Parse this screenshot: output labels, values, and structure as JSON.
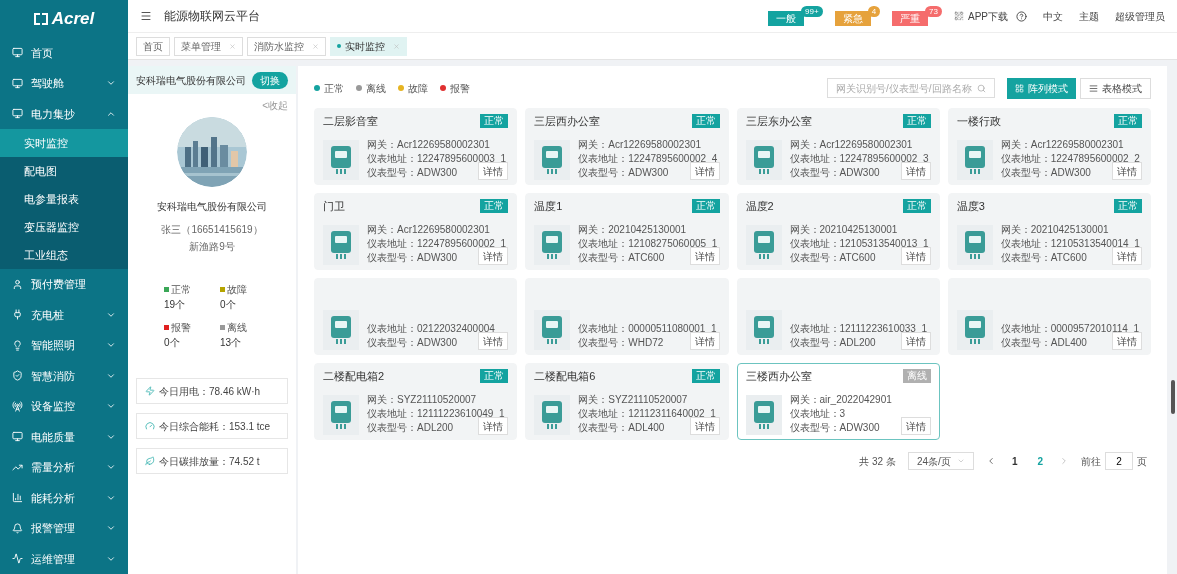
{
  "logo": "Acrel",
  "sidebar": {
    "items": [
      {
        "label": "首页"
      },
      {
        "label": "驾驶舱",
        "expanded": false
      },
      {
        "label": "电力集抄",
        "expanded": true,
        "children": [
          {
            "label": "实时监控",
            "selected": true
          },
          {
            "label": "配电图",
            "selected": false
          },
          {
            "label": "电参量报表",
            "selected": false
          },
          {
            "label": "变压器监控",
            "selected": false
          },
          {
            "label": "工业组态",
            "selected": false
          }
        ]
      },
      {
        "label": "预付费管理"
      },
      {
        "label": "充电桩",
        "expanded": false
      },
      {
        "label": "智能照明",
        "expanded": false
      },
      {
        "label": "智慧消防",
        "expanded": false
      },
      {
        "label": "设备监控",
        "expanded": false
      },
      {
        "label": "电能质量",
        "expanded": false
      },
      {
        "label": "需量分析",
        "expanded": false
      },
      {
        "label": "能耗分析",
        "expanded": false
      },
      {
        "label": "报警管理",
        "expanded": false
      },
      {
        "label": "运维管理",
        "expanded": false
      }
    ]
  },
  "header": {
    "title": "能源物联网云平台",
    "alarms": [
      {
        "label": "一般",
        "count": "99+",
        "color": "#14a3a0"
      },
      {
        "label": "紧急",
        "count": "4",
        "color": "#e6a23c"
      },
      {
        "label": "严重",
        "count": "73",
        "color": "#f56c6c"
      }
    ],
    "links": [
      "APP下载",
      "中文",
      "主题",
      "超级管理员"
    ]
  },
  "tabs": [
    {
      "label": "首页",
      "selected": false
    },
    {
      "label": "菜单管理",
      "selected": false
    },
    {
      "label": "消防水监控",
      "selected": false
    },
    {
      "label": "实时监控",
      "selected": true
    }
  ],
  "company_panel": {
    "name": "安科瑞电气股份有限公司",
    "switch_button": "切换",
    "collapse": "<收起",
    "company": "安科瑞电气股份有限公司",
    "contact": "张三（16651415619）",
    "address": "新渔路9号",
    "stats": [
      {
        "label": "正常",
        "count": "19个",
        "color": "#3aa757"
      },
      {
        "label": "故障",
        "count": "0个",
        "color": "#b5a400"
      },
      {
        "label": "报警",
        "count": "0个",
        "color": "#e02020"
      },
      {
        "label": "离线",
        "count": "13个",
        "color": "#999999"
      }
    ],
    "metrics": [
      "今日用电：78.46 kW·h",
      "今日综合能耗：153.1 tce",
      "今日碳排放量：74.52 t"
    ]
  },
  "legend": [
    {
      "label": "正常",
      "color": "#14a3a0"
    },
    {
      "label": "离线",
      "color": "#999999"
    },
    {
      "label": "故障",
      "color": "#e6b422"
    },
    {
      "label": "报警",
      "color": "#e03030"
    }
  ],
  "search": {
    "placeholder": "网关识别号/仪表型号/回路名称"
  },
  "view_modes": [
    {
      "label": "阵列模式",
      "selected": true
    },
    {
      "label": "表格模式",
      "selected": false
    }
  ],
  "cards": [
    {
      "title": "二层影音室",
      "status_label": "正常",
      "offline": false,
      "selected": false,
      "lines": [
        "网关：Acr12269580002301",
        "仪表地址：12247895600003_1",
        "仪表型号：ADW300"
      ],
      "button": "详情"
    },
    {
      "title": "三层西办公室",
      "status_label": "正常",
      "offline": false,
      "selected": false,
      "lines": [
        "网关：Acr12269580002301",
        "仪表地址：12247895600002_4",
        "仪表型号：ADW300"
      ],
      "button": "详情"
    },
    {
      "title": "三层东办公室",
      "status_label": "正常",
      "offline": false,
      "selected": false,
      "lines": [
        "网关：Acr12269580002301",
        "仪表地址：12247895600002_3",
        "仪表型号：ADW300"
      ],
      "button": "详情"
    },
    {
      "title": "一楼行政",
      "status_label": "正常",
      "offline": false,
      "selected": false,
      "lines": [
        "网关：Acr12269580002301",
        "仪表地址：12247895600002_2",
        "仪表型号：ADW300"
      ],
      "button": "详情"
    },
    {
      "title": "门卫",
      "status_label": "正常",
      "offline": false,
      "selected": false,
      "lines": [
        "网关：Acr12269580002301",
        "仪表地址：12247895600002_1",
        "仪表型号：ADW300"
      ],
      "button": "详情"
    },
    {
      "title": "温度1",
      "status_label": "正常",
      "offline": false,
      "selected": false,
      "lines": [
        "网关：20210425130001",
        "仪表地址：12108275060005_1",
        "仪表型号：ATC600"
      ],
      "button": "详情"
    },
    {
      "title": "温度2",
      "status_label": "正常",
      "offline": false,
      "selected": false,
      "lines": [
        "网关：20210425130001",
        "仪表地址：12105313540013_1",
        "仪表型号：ATC600"
      ],
      "button": "详情"
    },
    {
      "title": "温度3",
      "status_label": "正常",
      "offline": false,
      "selected": false,
      "lines": [
        "网关：20210425130001",
        "仪表地址：12105313540014_1",
        "仪表型号：ATC600"
      ],
      "button": "详情"
    },
    {
      "selected": false,
      "lines": [
        "仪表地址：02122032400004",
        "仪表型号：ADW300"
      ],
      "button": "详情"
    },
    {
      "selected": false,
      "lines": [
        "仪表地址：00000511080001_1",
        "仪表型号：WHD72"
      ],
      "button": "详情"
    },
    {
      "selected": false,
      "lines": [
        "仪表地址：12111223610033_1",
        "仪表型号：ADL200"
      ],
      "button": "详情"
    },
    {
      "selected": false,
      "lines": [
        "仪表地址：00009572010114_1",
        "仪表型号：ADL400"
      ],
      "button": "详情"
    },
    {
      "title": "二楼配电箱2",
      "status_label": "正常",
      "offline": false,
      "selected": false,
      "lines": [
        "网关：SYZ21110520007",
        "仪表地址：12111223610049_1",
        "仪表型号：ADL200"
      ],
      "button": "详情"
    },
    {
      "title": "二楼配电箱6",
      "status_label": "正常",
      "offline": false,
      "selected": false,
      "lines": [
        "网关：SYZ21110520007",
        "仪表地址：12112311640002_1",
        "仪表型号：ADL400"
      ],
      "button": "详情"
    },
    {
      "title": "三楼西办公室",
      "status_label": "离线",
      "offline": true,
      "selected": true,
      "lines": [
        "网关：air_2022042901",
        "仪表地址：3",
        "仪表型号：ADW300"
      ],
      "button": "详情"
    }
  ],
  "pagination": {
    "total": "共 32 条",
    "page_size": "24条/页",
    "pages": [
      {
        "label": "1",
        "selected": false
      },
      {
        "label": "2",
        "selected": true
      }
    ],
    "goto": "前往",
    "goto_value": "2",
    "page_unit": "页"
  }
}
